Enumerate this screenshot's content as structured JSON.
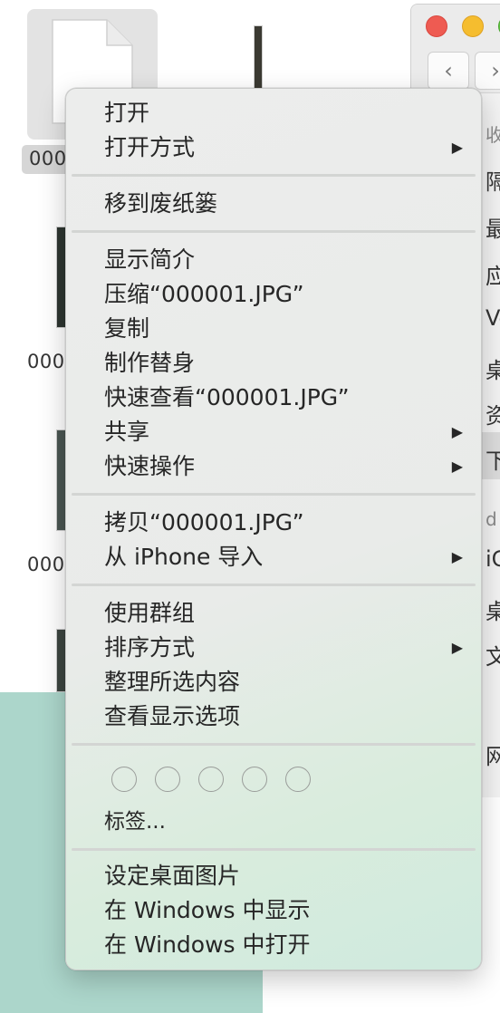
{
  "files": {
    "labels": [
      "000",
      "000",
      "000"
    ]
  },
  "right_finder": {
    "nav_back": "‹",
    "nav_forward": "›",
    "sidebar_fragments": [
      "收藏",
      "隔",
      "最",
      "应",
      "Ve",
      "桌",
      "资",
      "下",
      "d",
      "iC",
      "桌",
      "文",
      "网"
    ]
  },
  "context_menu": {
    "group1": {
      "open": "打开",
      "open_with": "打开方式"
    },
    "group2": {
      "move_to_trash": "移到废纸篓"
    },
    "group3": {
      "get_info": "显示简介",
      "compress": "压缩“000001.JPG”",
      "duplicate": "复制",
      "make_alias": "制作替身",
      "quick_look": "快速查看“000001.JPG”",
      "share": "共享",
      "quick_actions": "快速操作"
    },
    "group4": {
      "copy": "拷贝“000001.JPG”",
      "import_from_iphone": "从 iPhone 导入"
    },
    "group5": {
      "use_groups": "使用群组",
      "sort_by": "排序方式",
      "clean_up_selection": "整理所选内容",
      "show_view_options": "查看显示选项"
    },
    "group6": {
      "tags": "标签..."
    },
    "group7": {
      "set_desktop_picture": "设定桌面图片",
      "show_in_windows": "在 Windows 中显示",
      "open_in_windows": "在 Windows 中打开"
    },
    "submenu_arrow": "▶"
  },
  "colors": {
    "close": "#ee5b52",
    "minimize": "#f5bd2f",
    "zoom": "#5fc43f",
    "desktop": "#acd6cb"
  }
}
